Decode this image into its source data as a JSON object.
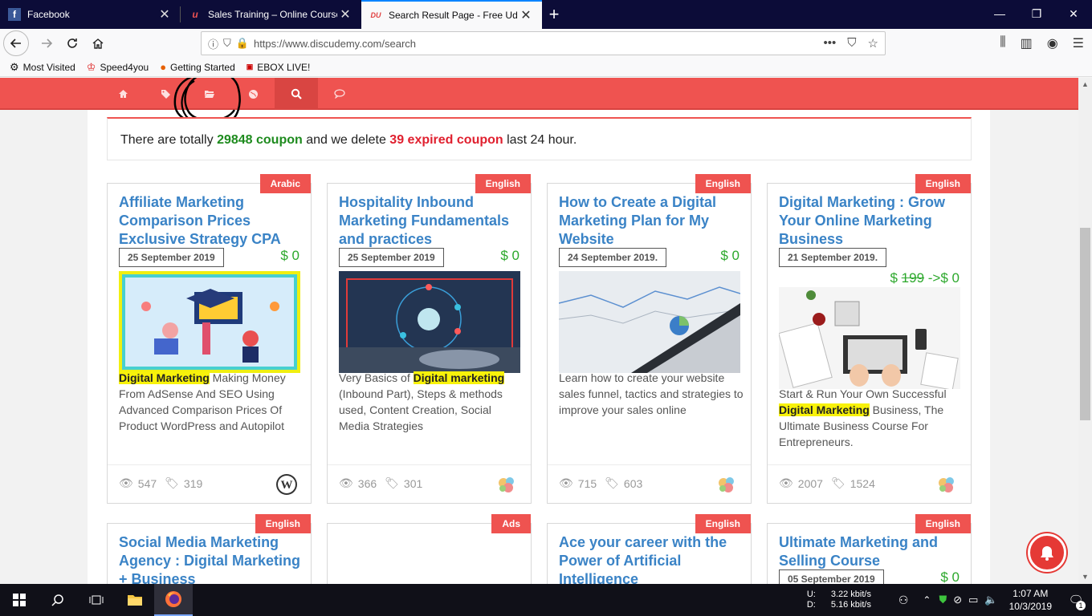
{
  "browser": {
    "tabs": [
      {
        "label": "Facebook",
        "icon": "facebook-icon"
      },
      {
        "label": "Sales Training – Online Courses",
        "icon": "udemy-icon"
      },
      {
        "label": "Search Result Page - Free Udemy",
        "icon": "discudemy-icon"
      }
    ],
    "url": "https://www.discudemy.com/search",
    "bookmarks": [
      "Most Visited",
      "Speed4you",
      "Getting Started",
      "EBOX LIVE!"
    ]
  },
  "site_nav": {
    "icons": [
      "home-icon",
      "tags-icon",
      "folder-icon",
      "globe-icon",
      "search-icon",
      "comment-icon"
    ]
  },
  "notice": {
    "prefix": "There are totally ",
    "coupon_count": "29848 coupon",
    "middle": " and we delete ",
    "expired_count": "39 expired coupon",
    "suffix": " last 24 hour."
  },
  "cards": [
    {
      "lang": "Arabic",
      "title": "Affiliate Marketing Comparison Prices Exclusive Strategy CPA",
      "date": "25 September 2019",
      "price": "$ 0",
      "desc_hl": "Digital Marketing",
      "desc_rest": " Making Money From AdSense And SEO Using Advanced Comparison Prices Of Product WordPress and Autopilot",
      "views": "547",
      "coupons": "319",
      "provider": "wordpress-icon"
    },
    {
      "lang": "English",
      "title": "Hospitality Inbound Marketing Fundamentals and practices",
      "date": "25 September 2019",
      "price": "$ 0",
      "desc_pre": "Very Basics of ",
      "desc_hl": "Digital marketing",
      "desc_rest": " (Inbound Part), Steps & methods used, Content Creation, Social Media Strategies",
      "views": "366",
      "coupons": "301",
      "provider": "udemy-icon"
    },
    {
      "lang": "English",
      "title": "How to Create a Digital Marketing Plan for My Website",
      "date": "24 September 2019.",
      "price": "$ 0",
      "desc_rest": "Learn how to create your website sales funnel, tactics and strategies to improve your sales online",
      "views": "715",
      "coupons": "603",
      "provider": "udemy-icon"
    },
    {
      "lang": "English",
      "title": "Digital Marketing : Grow Your Online Marketing Business",
      "date": "21 September 2019.",
      "price_old": "199",
      "price_new": "$ 0",
      "desc_pre": "Start & Run Your Own Successful ",
      "desc_hl": "Digital Marketing",
      "desc_rest": " Business, The Ultimate Business Course For Entrepreneurs.",
      "views": "2007",
      "coupons": "1524",
      "provider": "udemy-icon"
    },
    {
      "lang": "English",
      "title": "Social Media Marketing Agency : Digital Marketing + Business"
    },
    {
      "lang": "Ads"
    },
    {
      "lang": "English",
      "title": "Ace your career with the Power of Artificial Intelligence"
    },
    {
      "lang": "English",
      "title": "Ultimate Marketing and Selling Course",
      "date": "05 September 2019",
      "price": "$ 0"
    }
  ],
  "taskbar": {
    "net_u_label": "U:",
    "net_u": "3.22 kbit/s",
    "net_d_label": "D:",
    "net_d": "5.16 kbit/s",
    "time": "1:07 AM",
    "date": "10/3/2019",
    "notif_count": "1"
  }
}
